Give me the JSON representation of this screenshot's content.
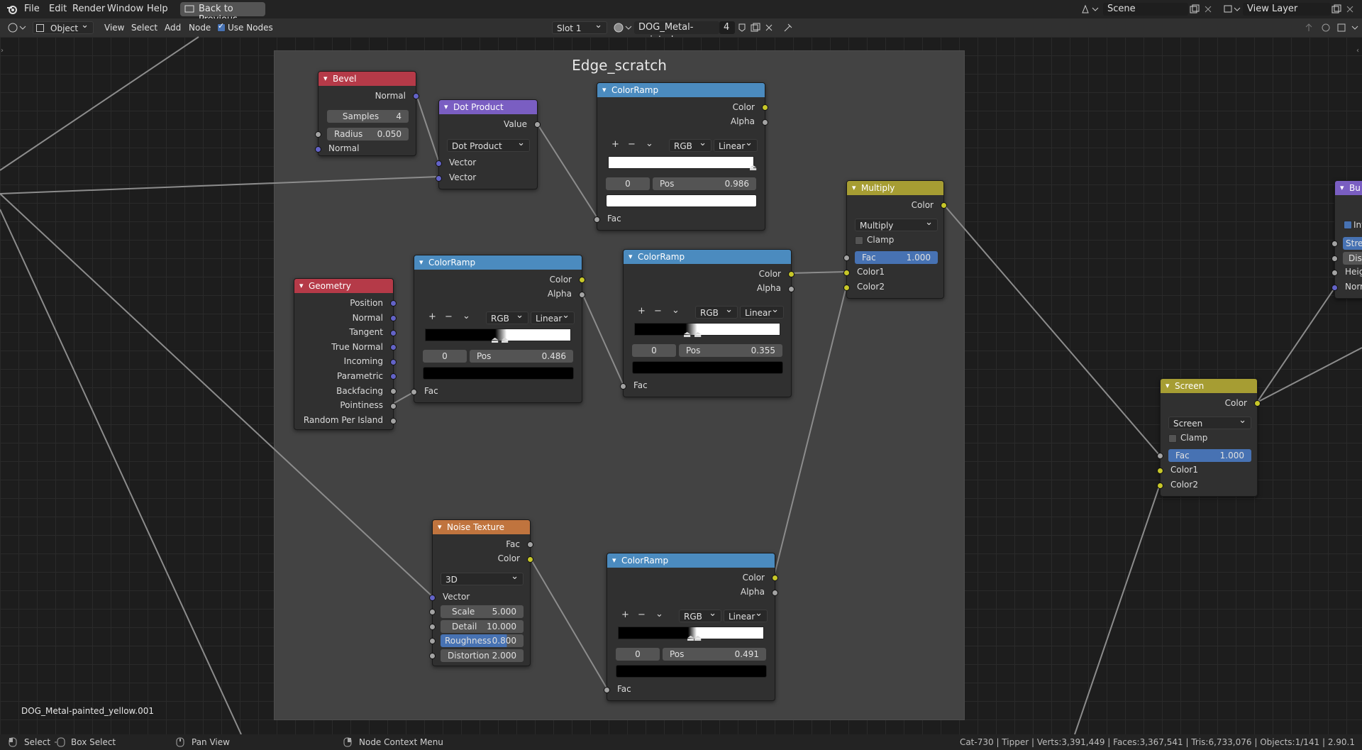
{
  "menubar": {
    "items": [
      "File",
      "Edit",
      "Render",
      "Window",
      "Help"
    ],
    "back_button": "Back to Previous",
    "scene": "Scene",
    "view_layer": "View Layer"
  },
  "header": {
    "mode": "Object",
    "menus": [
      "View",
      "Select",
      "Add",
      "Node"
    ],
    "use_nodes": "Use Nodes",
    "slot": "Slot 1",
    "material": "DOG_Metal-painted...",
    "users": "4"
  },
  "frame": {
    "title": "Edge_scratch"
  },
  "nodes": {
    "bevel": {
      "title": "Bevel",
      "out_normal": "Normal",
      "samples_label": "Samples",
      "samples": "4",
      "radius_label": "Radius",
      "radius": "0.050",
      "in_normal": "Normal"
    },
    "dot": {
      "title": "Dot Product",
      "out_value": "Value",
      "op": "Dot Product",
      "in1": "Vector",
      "in2": "Vector"
    },
    "ramp1": {
      "title": "ColorRamp",
      "out_color": "Color",
      "out_alpha": "Alpha",
      "mode": "RGB",
      "interp": "Linear",
      "index": "0",
      "pos_label": "Pos",
      "pos": "0.986",
      "in_fac": "Fac"
    },
    "geometry": {
      "title": "Geometry",
      "outs": [
        "Position",
        "Normal",
        "Tangent",
        "True Normal",
        "Incoming",
        "Parametric",
        "Backfacing",
        "Pointiness",
        "Random Per Island"
      ]
    },
    "ramp2": {
      "title": "ColorRamp",
      "out_color": "Color",
      "out_alpha": "Alpha",
      "mode": "RGB",
      "interp": "Linear",
      "index": "0",
      "pos_label": "Pos",
      "pos": "0.486",
      "in_fac": "Fac"
    },
    "ramp3": {
      "title": "ColorRamp",
      "out_color": "Color",
      "out_alpha": "Alpha",
      "mode": "RGB",
      "interp": "Linear",
      "index": "0",
      "pos_label": "Pos",
      "pos": "0.355",
      "in_fac": "Fac"
    },
    "multiply": {
      "title": "Multiply",
      "out_color": "Color",
      "op": "Multiply",
      "clamp": "Clamp",
      "fac_label": "Fac",
      "fac": "1.000",
      "in1": "Color1",
      "in2": "Color2"
    },
    "noise": {
      "title": "Noise Texture",
      "out_fac": "Fac",
      "out_color": "Color",
      "dim": "3D",
      "in_vector": "Vector",
      "scale_label": "Scale",
      "scale": "5.000",
      "detail_label": "Detail",
      "detail": "10.000",
      "rough_label": "Roughness",
      "rough": "0.800",
      "dist_label": "Distortion",
      "dist": "2.000"
    },
    "ramp4": {
      "title": "ColorRamp",
      "out_color": "Color",
      "out_alpha": "Alpha",
      "mode": "RGB",
      "interp": "Linear",
      "index": "0",
      "pos_label": "Pos",
      "pos": "0.491",
      "in_fac": "Fac"
    },
    "screen": {
      "title": "Screen",
      "out_color": "Color",
      "op": "Screen",
      "clamp": "Clamp",
      "fac_label": "Fac",
      "fac": "1.000",
      "in1": "Color1",
      "in2": "Color2"
    },
    "bump": {
      "title": "Bu",
      "inv": "Inv",
      "str": "Stre",
      "dist": "Dis",
      "height": "Heigh",
      "normal": "Norm"
    }
  },
  "material_label": "DOG_Metal-painted_yellow.001",
  "status": {
    "select": "Select",
    "box_select": "Box Select",
    "pan": "Pan View",
    "context": "Node Context Menu",
    "stats": "Cat-730 | Tipper | Verts:3,391,449 | Faces:3,367,541 | Tris:6,733,076 | Objects:1/141 | 2.90.1"
  }
}
